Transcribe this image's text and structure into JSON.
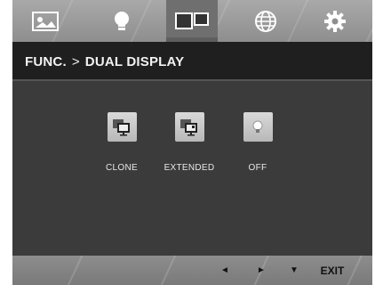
{
  "tabs": [
    {
      "icon": "picture-icon",
      "active": false
    },
    {
      "icon": "bulb-icon",
      "active": false
    },
    {
      "icon": "dual-display-icon",
      "active": true
    },
    {
      "icon": "globe-icon",
      "active": false
    },
    {
      "icon": "gear-icon",
      "active": false
    }
  ],
  "header": {
    "section": "FUNC.",
    "separator": ">",
    "title": "DUAL DISPLAY"
  },
  "options": [
    {
      "label": "CLONE",
      "icon": "clone-icon"
    },
    {
      "label": "EXTENDED",
      "icon": "extended-icon"
    },
    {
      "label": "OFF",
      "icon": "off-icon"
    }
  ],
  "bottom": {
    "left": "◄",
    "right": "►",
    "down": "▼",
    "exit": "EXIT"
  },
  "colors": {
    "panel": "#3b3b3b",
    "header": "#1f1f1f",
    "tabbar": "#9e9e9e",
    "active_tab": "#6f6f6f"
  }
}
